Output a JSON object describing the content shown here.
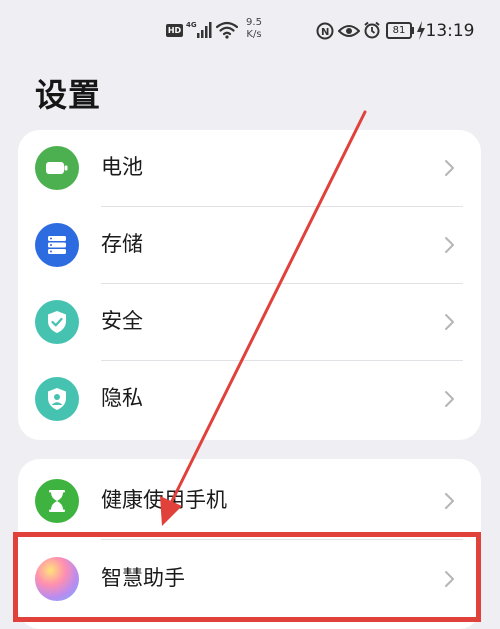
{
  "status_bar": {
    "hd_badge": "HD",
    "network_type": "4G",
    "speed_value": "9.5",
    "speed_unit": "K/s",
    "battery_level": "81",
    "time": "13:19"
  },
  "page": {
    "title": "设置"
  },
  "sections": [
    {
      "items": [
        {
          "label": "电池",
          "icon": "battery-icon",
          "color": "#4caf50"
        },
        {
          "label": "存储",
          "icon": "storage-icon",
          "color": "#2d6be0"
        },
        {
          "label": "安全",
          "icon": "shield-check-icon",
          "color": "#45c3b0"
        },
        {
          "label": "隐私",
          "icon": "privacy-shield-icon",
          "color": "#45c3b0"
        }
      ]
    },
    {
      "items": [
        {
          "label": "健康使用手机",
          "icon": "hourglass-icon",
          "color": "#3fb33f"
        },
        {
          "label": "智慧助手",
          "icon": "smart-assistant-icon",
          "color": "#c86fe6"
        }
      ]
    }
  ],
  "colors": {
    "background": "#efeff3",
    "card": "#ffffff",
    "annotation_red": "#e0413a"
  }
}
